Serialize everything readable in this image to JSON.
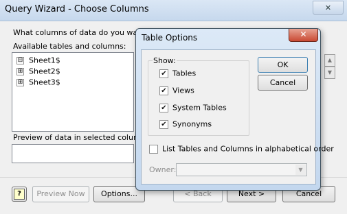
{
  "main_window": {
    "title": "Query Wizard - Choose Columns",
    "prompt": "What columns of data do you want to",
    "available_label": "Available tables and columns:",
    "tree": [
      {
        "label": "Sheet1$",
        "expander": "⊟"
      },
      {
        "label": "Sheet2$",
        "expander": "⊞"
      },
      {
        "label": "Sheet3$",
        "expander": "⊞"
      }
    ],
    "preview_label": "Preview of data in selected column:",
    "buttons": {
      "help": "?",
      "preview_now": "Preview Now",
      "options": "Options...",
      "back": "< Back",
      "next": "Next >",
      "cancel": "Cancel"
    }
  },
  "dialog": {
    "title": "Table Options",
    "show_label": "Show:",
    "show_options": [
      {
        "label": "Tables",
        "checked": true
      },
      {
        "label": "Views",
        "checked": true
      },
      {
        "label": "System Tables",
        "checked": true
      },
      {
        "label": "Synonyms",
        "checked": true
      }
    ],
    "alpha_order_label": "List Tables and Columns in alphabetical order",
    "alpha_order_checked": false,
    "owner_label": "Owner:",
    "ok": "OK",
    "cancel": "Cancel"
  },
  "icons": {
    "close": "close-icon",
    "help": "help-icon",
    "check": "checkmark-icon",
    "dropdown": "chevron-down-icon"
  }
}
